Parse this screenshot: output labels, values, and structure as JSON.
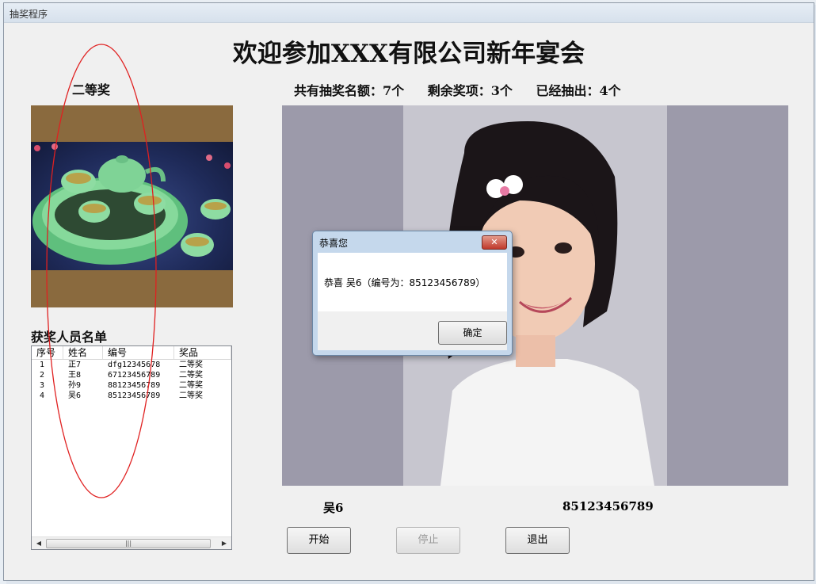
{
  "window": {
    "title": "抽奖程序"
  },
  "header": {
    "title": "欢迎参加XXX有限公司新年宴会",
    "prize_level": "二等奖",
    "stats": {
      "total": "共有抽奖名额：7个",
      "remaining": "剩余奖项：3个",
      "drawn": "已经抽出：4个"
    }
  },
  "prize_image": {
    "icon": "tea-set-image"
  },
  "winners": {
    "title": "获奖人员名单",
    "columns": [
      "序号",
      "姓名",
      "编号",
      "奖品"
    ],
    "rows": [
      [
        "1",
        "正7",
        "dfg12345678",
        "二等奖"
      ],
      [
        "2",
        "王8",
        "67123456789",
        "二等奖"
      ],
      [
        "3",
        "孙9",
        "88123456789",
        "二等奖"
      ],
      [
        "4",
        "吴6",
        "85123456789",
        "二等奖"
      ]
    ],
    "scroll_thumb": "|||"
  },
  "current": {
    "name": "吴6",
    "code": "85123456789"
  },
  "buttons": {
    "start": "开始",
    "stop": "停止",
    "exit": "退出"
  },
  "dialog": {
    "title": "恭喜您",
    "message": "恭喜 吴6（编号为：85123456789）",
    "ok": "确定",
    "close": "✕"
  }
}
